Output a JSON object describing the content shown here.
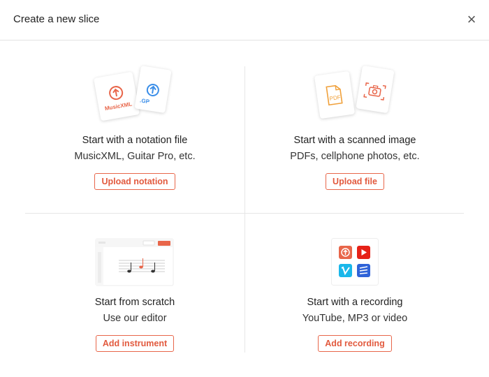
{
  "header": {
    "title": "Create a new slice",
    "close_label": "×"
  },
  "options": [
    {
      "heading": "Start with a notation file",
      "subtitle": "MusicXML, Guitar Pro, etc.",
      "button": "Upload notation",
      "icon_labels": [
        "MusicXML",
        ".GP"
      ]
    },
    {
      "heading": "Start with a scanned image",
      "subtitle": "PDFs, cellphone photos, etc.",
      "button": "Upload file",
      "icon_labels": [
        "PDF"
      ]
    },
    {
      "heading": "Start from scratch",
      "subtitle": "Use our editor",
      "button": "Add instrument"
    },
    {
      "heading": "Start with a recording",
      "subtitle": "YouTube, MP3 or video",
      "button": "Add recording"
    }
  ],
  "colors": {
    "accent": "#e8664a",
    "blue": "#3b8ee8",
    "orange": "#f0a03a",
    "youtube": "#e62117",
    "vimeo": "#1ab7ea",
    "soundslice": "#2f63d8"
  },
  "icons": [
    "upload-arrow-icon",
    "pdf-file-icon",
    "camera-icon",
    "music-editor-icon",
    "youtube-icon",
    "vimeo-icon",
    "wave-icon"
  ]
}
